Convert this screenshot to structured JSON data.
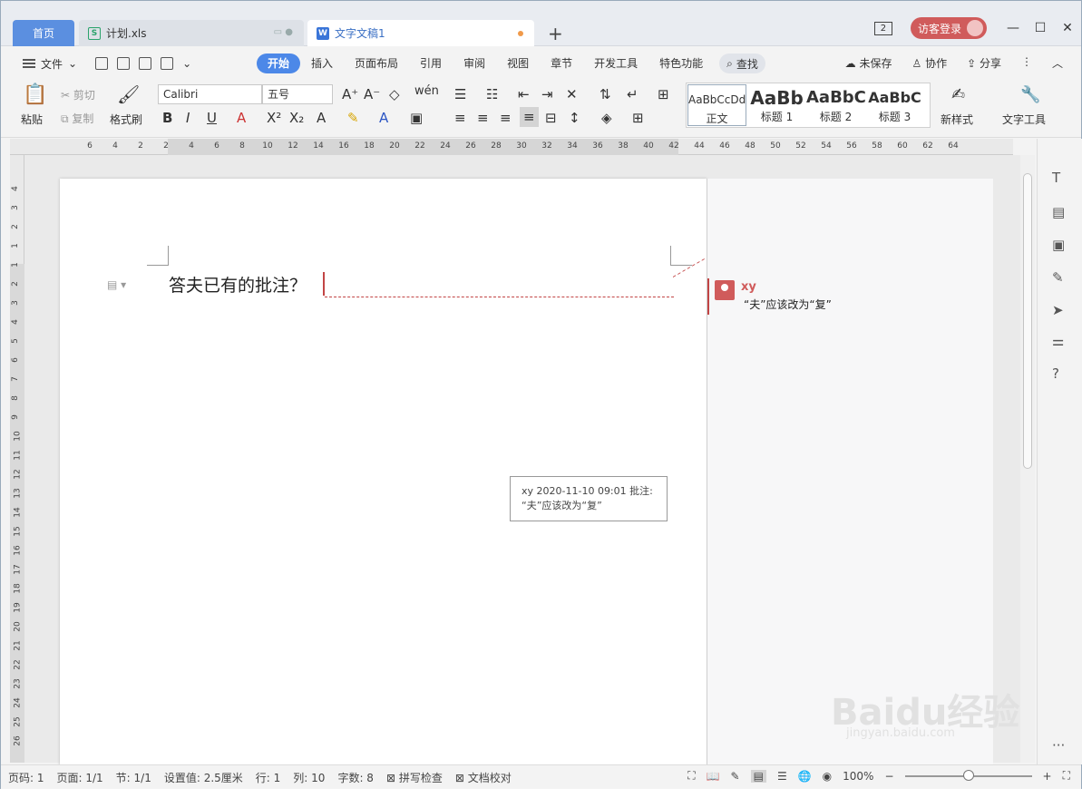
{
  "tabs": [
    {
      "label": "首页"
    },
    {
      "label": "计划.xls",
      "icon": "S"
    },
    {
      "label": "文字文稿1",
      "icon": "W"
    }
  ],
  "titlebar": {
    "badge": "2",
    "login": "访客登录"
  },
  "menu": {
    "file": "文件",
    "tabs": [
      "开始",
      "插入",
      "页面布局",
      "引用",
      "审阅",
      "视图",
      "章节",
      "开发工具",
      "特色功能"
    ],
    "search": "查找",
    "right": [
      "未保存",
      "协作",
      "分享"
    ]
  },
  "ribbon": {
    "paste": "粘贴",
    "cut": "剪切",
    "copy": "复制",
    "format_painter": "格式刷",
    "font_name": "Calibri",
    "font_size": "五号",
    "styles": [
      {
        "preview": "AaBbCcDd",
        "name": "正文"
      },
      {
        "preview": "AaBb",
        "name": "标题 1"
      },
      {
        "preview": "AaBbC",
        "name": "标题 2"
      },
      {
        "preview": "AaBbC",
        "name": "标题 3"
      }
    ],
    "new_style": "新样式",
    "text_tools": "文字工具"
  },
  "ruler": {
    "h": [
      "6",
      "4",
      "2",
      "2",
      "4",
      "6",
      "8",
      "10",
      "12",
      "14",
      "16",
      "18",
      "20",
      "22",
      "24",
      "26",
      "28",
      "30",
      "32",
      "34",
      "36",
      "38",
      "40",
      "42",
      "44",
      "46",
      "48",
      "50",
      "52",
      "54",
      "56",
      "58",
      "60",
      "62",
      "64"
    ],
    "v": [
      "4",
      "3",
      "2",
      "1",
      "1",
      "2",
      "3",
      "4",
      "5",
      "6",
      "7",
      "8",
      "9",
      "10",
      "11",
      "12",
      "13",
      "14",
      "15",
      "16",
      "17",
      "18",
      "19",
      "20",
      "21",
      "22",
      "23",
      "24",
      "25",
      "26"
    ]
  },
  "document": {
    "text": "答夫已有的批注？"
  },
  "comment": {
    "author": "xy",
    "text": "“夫”应该改为“复”",
    "tooltip_header": "xy 2020-11-10 09:01 批注:",
    "tooltip_text": "“夫”应该改为“复”"
  },
  "status": {
    "page_num": "页码: 1",
    "pages": "页面: 1/1",
    "section": "节: 1/1",
    "setting": "设置值: 2.5厘米",
    "row": "行: 1",
    "col": "列: 10",
    "words": "字数: 8",
    "spell": "拼写检查",
    "proof": "文档校对",
    "zoom": "100%"
  },
  "watermark": {
    "line1": "Baidu经验",
    "line2": "jingyan.baidu.com"
  }
}
